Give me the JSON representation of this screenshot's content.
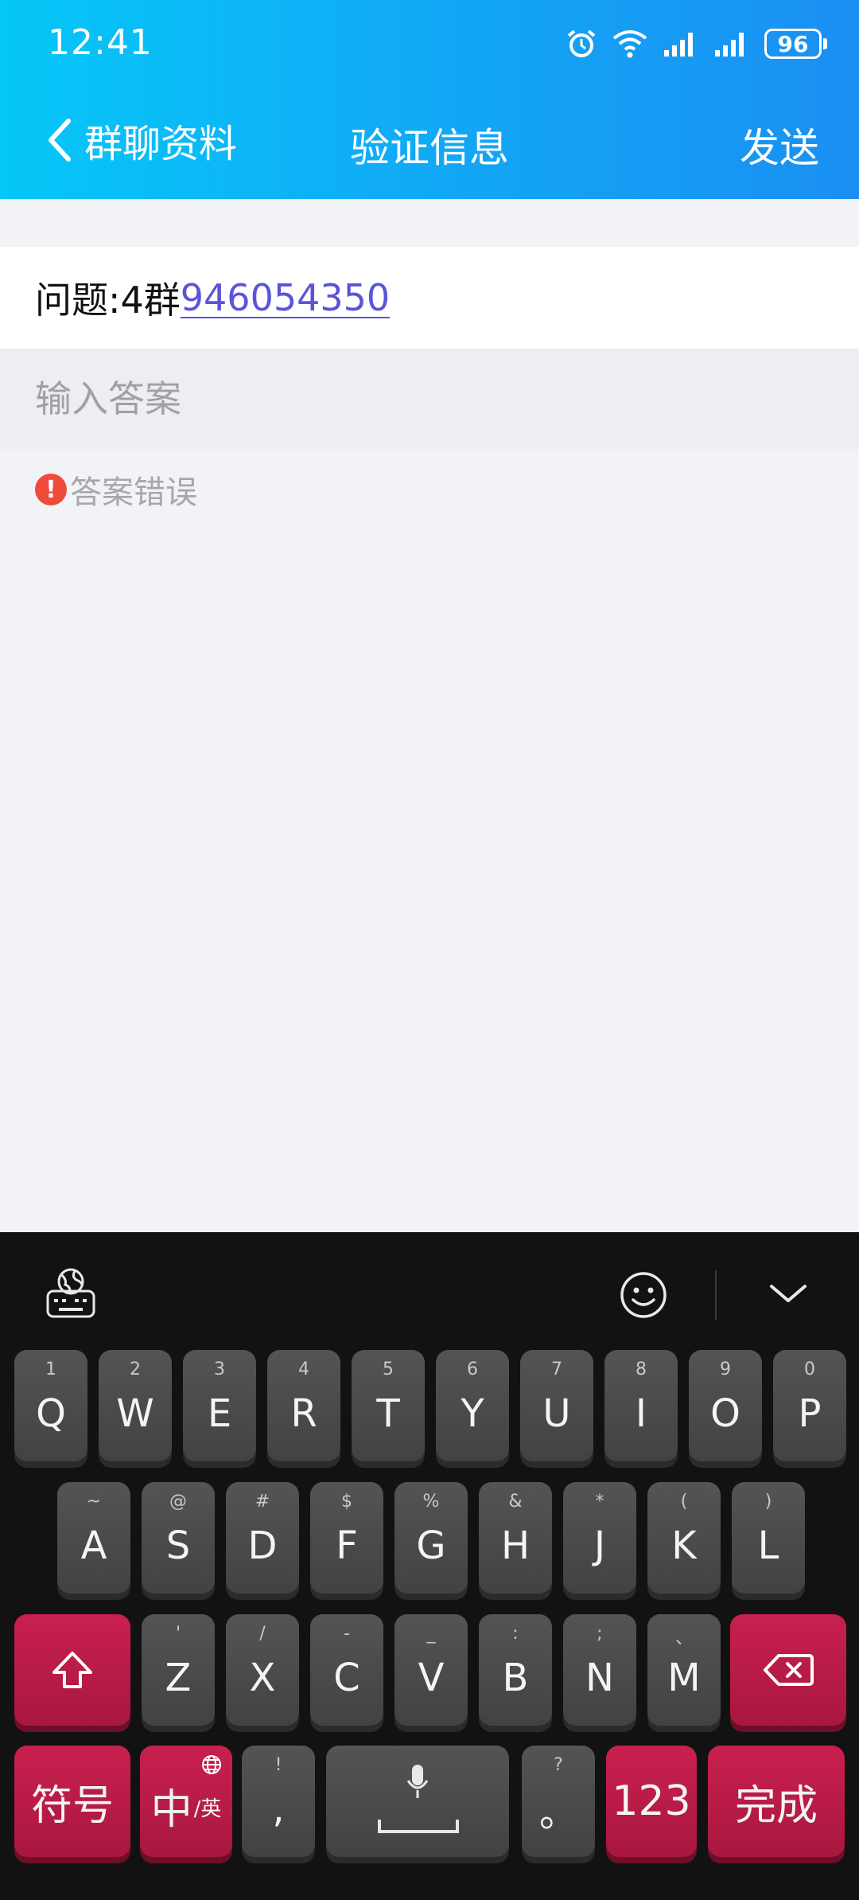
{
  "status_bar": {
    "time": "12:41",
    "battery": "96"
  },
  "nav": {
    "back_label": "群聊资料",
    "title": "验证信息",
    "send_label": "发送"
  },
  "question": {
    "prefix": "问题:4群",
    "link": "946054350"
  },
  "answer": {
    "placeholder": "输入答案",
    "value": ""
  },
  "error": {
    "icon": "!",
    "text": "答案错误"
  },
  "keyboard": {
    "row1": [
      {
        "sub": "1",
        "main": "Q"
      },
      {
        "sub": "2",
        "main": "W"
      },
      {
        "sub": "3",
        "main": "E"
      },
      {
        "sub": "4",
        "main": "R"
      },
      {
        "sub": "5",
        "main": "T"
      },
      {
        "sub": "6",
        "main": "Y"
      },
      {
        "sub": "7",
        "main": "U"
      },
      {
        "sub": "8",
        "main": "I"
      },
      {
        "sub": "9",
        "main": "O"
      },
      {
        "sub": "0",
        "main": "P"
      }
    ],
    "row2": [
      {
        "sub": "~",
        "main": "A"
      },
      {
        "sub": "@",
        "main": "S"
      },
      {
        "sub": "#",
        "main": "D"
      },
      {
        "sub": "$",
        "main": "F"
      },
      {
        "sub": "%",
        "main": "G"
      },
      {
        "sub": "&",
        "main": "H"
      },
      {
        "sub": "*",
        "main": "J"
      },
      {
        "sub": "(",
        "main": "K"
      },
      {
        "sub": ")",
        "main": "L"
      }
    ],
    "row3": [
      {
        "sub": "'",
        "main": "Z"
      },
      {
        "sub": "/",
        "main": "X"
      },
      {
        "sub": "-",
        "main": "C"
      },
      {
        "sub": "_",
        "main": "V"
      },
      {
        "sub": ":",
        "main": "B"
      },
      {
        "sub": ";",
        "main": "N"
      },
      {
        "sub": "、",
        "main": "M"
      }
    ],
    "symbols_label": "符号",
    "lang_main": "中",
    "lang_sub": "/英",
    "comma": {
      "sub": "!",
      "main": ","
    },
    "period": {
      "sub": "?",
      "main": "。"
    },
    "num_label": "123",
    "done_label": "完成"
  }
}
